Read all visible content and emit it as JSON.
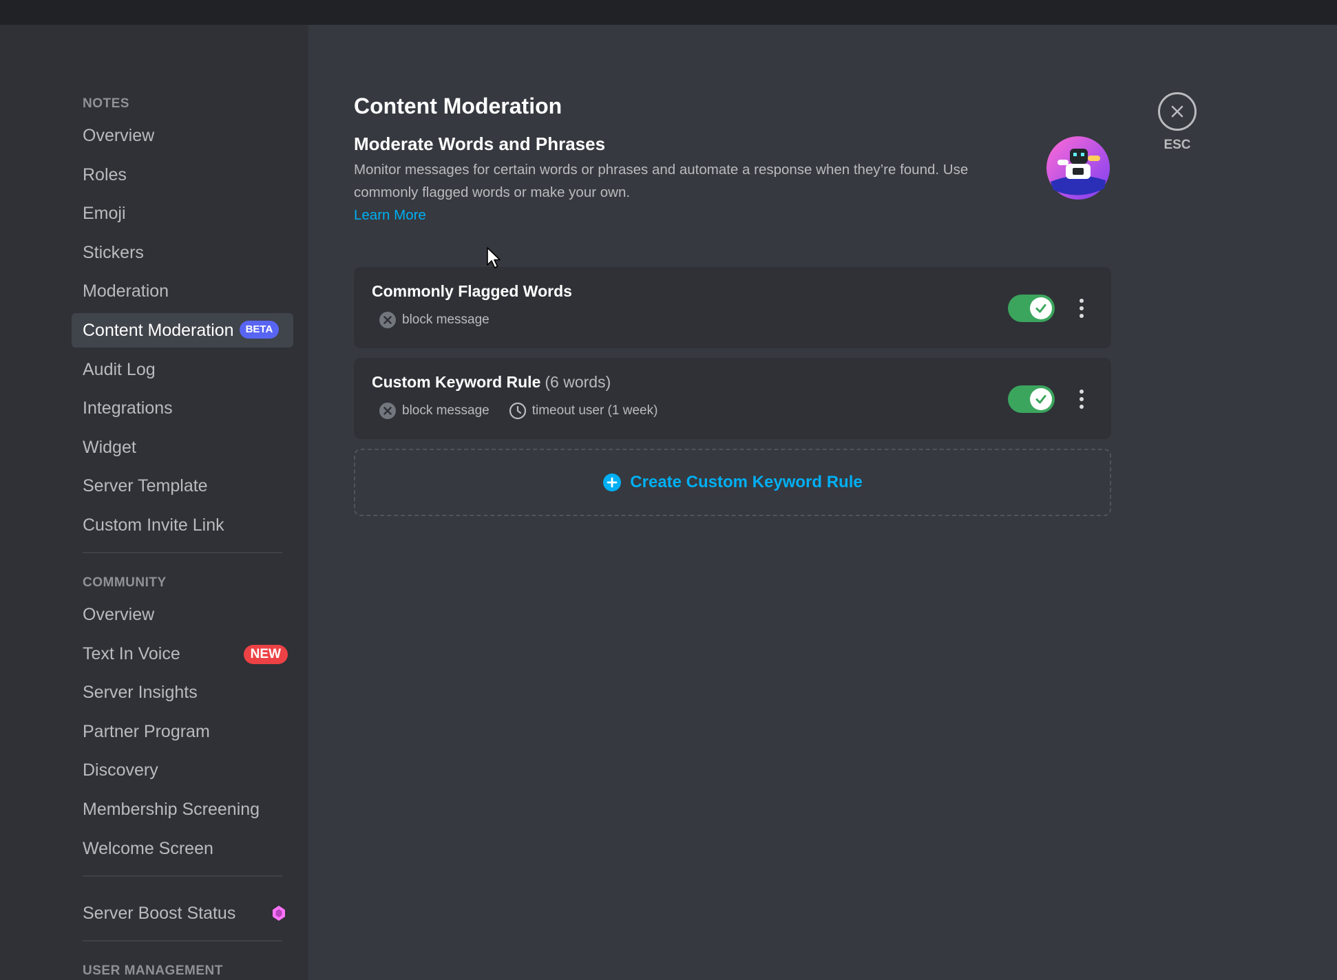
{
  "sidebar": {
    "sections": [
      {
        "header": "NOTES",
        "items": [
          {
            "label": "Overview"
          },
          {
            "label": "Roles"
          },
          {
            "label": "Emoji"
          },
          {
            "label": "Stickers"
          },
          {
            "label": "Moderation"
          },
          {
            "label": "Content Moderation",
            "badge": "BETA",
            "active": true
          },
          {
            "label": "Audit Log"
          },
          {
            "label": "Integrations"
          },
          {
            "label": "Widget"
          },
          {
            "label": "Server Template"
          },
          {
            "label": "Custom Invite Link"
          }
        ]
      },
      {
        "header": "COMMUNITY",
        "items": [
          {
            "label": "Overview"
          },
          {
            "label": "Text In Voice",
            "badge": "NEW"
          },
          {
            "label": "Server Insights"
          },
          {
            "label": "Partner Program"
          },
          {
            "label": "Discovery"
          },
          {
            "label": "Membership Screening"
          },
          {
            "label": "Welcome Screen"
          }
        ]
      }
    ],
    "boost": {
      "label": "Server Boost Status",
      "icon": "boost-gem-icon",
      "color": "#ff73fa"
    },
    "user_management_header": "USER MANAGEMENT"
  },
  "main": {
    "title": "Content Moderation",
    "intro": {
      "title": "Moderate Words and Phrases",
      "description": "Monitor messages for certain words or phrases and automate a response when they’re found. Use commonly flagged words or make your own.",
      "learn_more": "Learn More"
    },
    "rules": [
      {
        "title": "Commonly Flagged Words",
        "count": "",
        "enabled": true,
        "actions": [
          {
            "icon": "block-message-icon",
            "label": "block message"
          }
        ]
      },
      {
        "title": "Custom Keyword Rule",
        "count": "(6 words)",
        "enabled": true,
        "actions": [
          {
            "icon": "block-message-icon",
            "label": "block message"
          },
          {
            "icon": "clock-icon",
            "label": "timeout user (1 week)"
          }
        ]
      }
    ],
    "create_rule": "Create Custom Keyword Rule"
  },
  "close": {
    "label": "ESC"
  },
  "colors": {
    "accent_blue": "#00aff4",
    "toggle_on": "#3ba55d",
    "badge_beta": "#5865f2",
    "badge_new": "#ed4245"
  }
}
